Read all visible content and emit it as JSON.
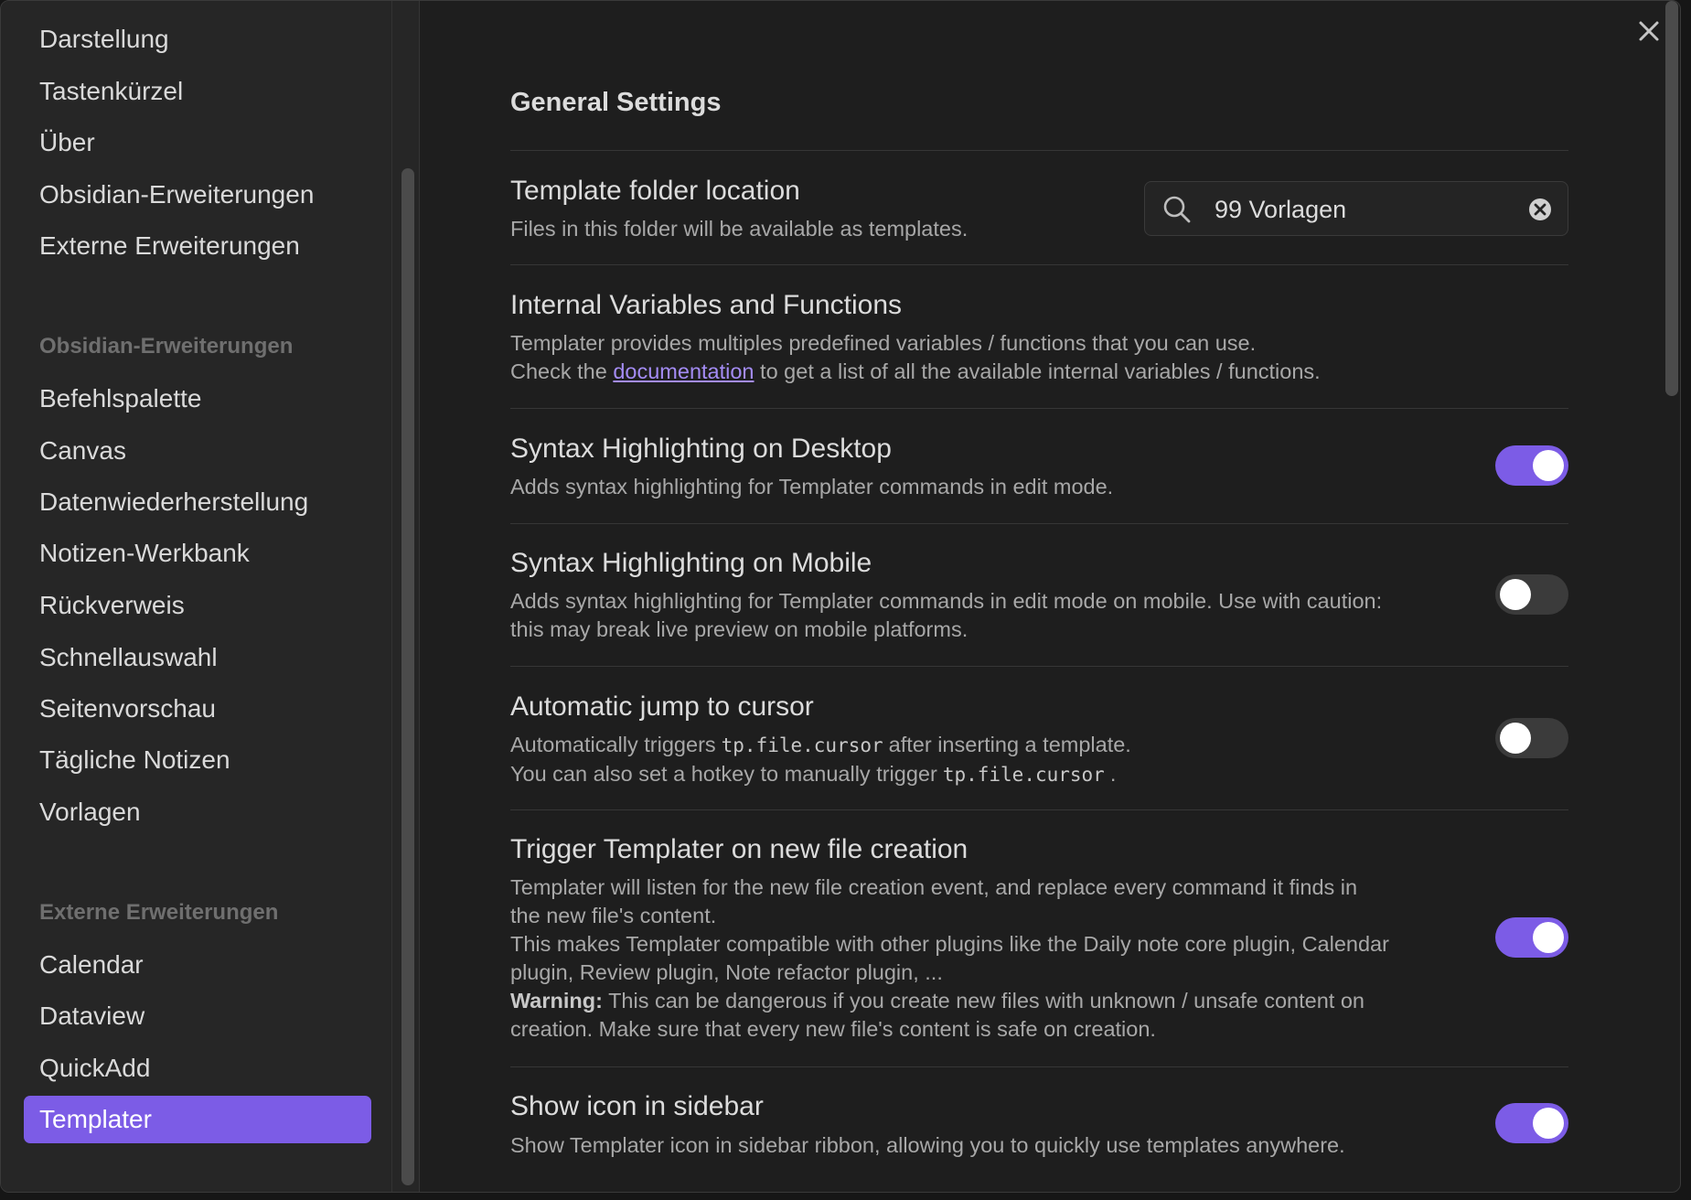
{
  "sidebar": {
    "top_items": [
      {
        "label": "Darstellung"
      },
      {
        "label": "Tastenkürzel"
      },
      {
        "label": "Über"
      },
      {
        "label": "Obsidian-Erweiterungen"
      },
      {
        "label": "Externe Erweiterungen"
      }
    ],
    "core_heading": "Obsidian-Erweiterungen",
    "core_items": [
      {
        "label": "Befehlspalette"
      },
      {
        "label": "Canvas"
      },
      {
        "label": "Datenwiederherstellung"
      },
      {
        "label": "Notizen-Werkbank"
      },
      {
        "label": "Rückverweis"
      },
      {
        "label": "Schnellauswahl"
      },
      {
        "label": "Seitenvorschau"
      },
      {
        "label": "Tägliche Notizen"
      },
      {
        "label": "Vorlagen"
      }
    ],
    "community_heading": "Externe Erweiterungen",
    "community_items": [
      {
        "label": "Calendar"
      },
      {
        "label": "Dataview"
      },
      {
        "label": "QuickAdd"
      },
      {
        "label": "Templater"
      }
    ],
    "active_item": "Templater"
  },
  "content": {
    "section_title": "General Settings",
    "template_folder": {
      "name": "Template folder location",
      "desc": "Files in this folder will be available as templates.",
      "value": "99 Vorlagen"
    },
    "internal_vars": {
      "name": "Internal Variables and Functions",
      "desc_line1": "Templater provides multiples predefined variables / functions that you can use.",
      "desc_prefix": "Check the",
      "desc_link": "documentation",
      "desc_suffix": "to get a list of all the available internal variables / functions."
    },
    "syntax_desktop": {
      "name": "Syntax Highlighting on Desktop",
      "desc": "Adds syntax highlighting for Templater commands in edit mode.",
      "enabled": true
    },
    "syntax_mobile": {
      "name": "Syntax Highlighting on Mobile",
      "desc_line1": "Adds syntax highlighting for Templater commands in edit mode on mobile. Use with caution:",
      "desc_line2": "this may break live preview on mobile platforms.",
      "enabled": false
    },
    "auto_jump": {
      "name": "Automatic jump to cursor",
      "desc_line1_prefix": "Automatically triggers",
      "desc_code": "tp.file.cursor",
      "desc_line1_suffix": "after inserting a template.",
      "desc_line2_prefix": "You can also set a hotkey to manually trigger",
      "desc_line2_suffix": ".",
      "enabled": false
    },
    "trigger_new_file": {
      "name": "Trigger Templater on new file creation",
      "desc_line1": "Templater will listen for the new file creation event, and replace every command it finds in",
      "desc_line2": "the new file's content.",
      "desc_line3": "This makes Templater compatible with other plugins like the Daily note core plugin, Calendar",
      "desc_line4": "plugin, Review plugin, Note refactor plugin, ...",
      "warning_label": "Warning:",
      "desc_line5": "This can be dangerous if you create new files with unknown / unsafe content on",
      "desc_line6": "creation. Make sure that every new file's content is safe on creation.",
      "enabled": true
    },
    "sidebar_icon": {
      "name": "Show icon in sidebar",
      "desc": "Show Templater icon in sidebar ribbon, allowing you to quickly use templates anywhere.",
      "enabled": true
    }
  },
  "colors": {
    "accent": "#7c5ce6",
    "background": "#1e1e1e",
    "sidebar": "#262626",
    "link": "#a48cf5"
  },
  "icons": {
    "close": "close-icon",
    "search": "search-icon",
    "clear": "clear-circle-icon"
  }
}
